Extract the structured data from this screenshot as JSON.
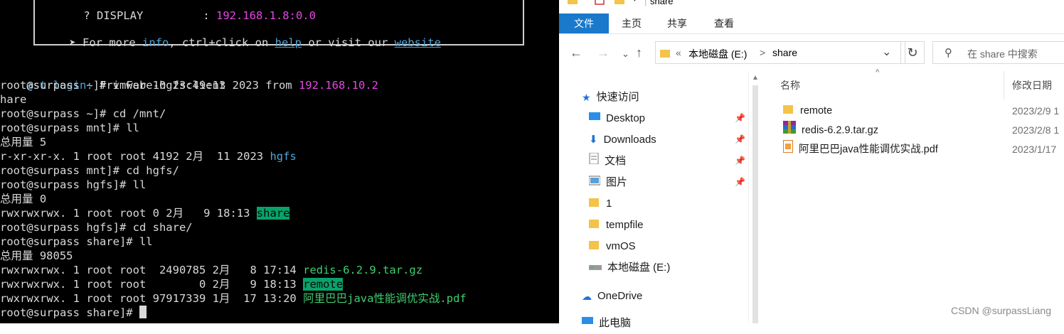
{
  "terminal": {
    "banner": {
      "display_label": "? DISPLAY",
      "display_value": "192.168.1.8:0.0",
      "info_line": {
        "arrow": "➤",
        "prefix": "For more ",
        "info": "info",
        "middle": ", ctrl+click on ",
        "help": "help",
        "or_visit": " or visit our ",
        "website": "website"
      }
    },
    "lines": [
      {
        "a": "ast login: ",
        "b": "Fri Feb 10 23:49:13 2023 from ",
        "c": "192.168.10.2"
      },
      {
        "text": "root@surpass ~]# vmware-hgfsclient"
      },
      {
        "text": "hare"
      },
      {
        "text": "root@surpass ~]# cd /mnt/"
      },
      {
        "text": "root@surpass mnt]# ll"
      },
      {
        "text": "总用量 5"
      },
      {
        "text": "r-xr-xr-x. 1 root root 4192 2月  11 2023 ",
        "item": "hgfs"
      },
      {
        "text": "root@surpass mnt]# cd hgfs/"
      },
      {
        "text": "root@surpass hgfs]# ll"
      },
      {
        "text": "总用量 0"
      },
      {
        "text": "rwxrwxrwx. 1 root root 0 2月   9 18:13 ",
        "item": "share"
      },
      {
        "text": "root@surpass hgfs]# cd share/"
      },
      {
        "text": "root@surpass share]# ll"
      },
      {
        "text": "总用量 98055"
      },
      {
        "text": "rwxrwxrwx. 1 root root  2490785 2月   8 17:14 ",
        "item": "redis-6.2.9.tar.gz"
      },
      {
        "text": "rwxrwxrwx. 1 root root        0 2月   9 18:13 ",
        "item": "remote"
      },
      {
        "text": "rwxrwxrwx. 1 root root 97917339 1月  17 13:20 ",
        "item": "阿里巴巴java性能调优实战.pdf"
      },
      {
        "text": "root@surpass share]# "
      }
    ]
  },
  "explorer": {
    "title": "share",
    "ribbon_tabs": [
      "文件",
      "主页",
      "共享",
      "查看"
    ],
    "address": {
      "chevrons": "«",
      "drive": "本地磁盘 (E:)",
      "arrow": ">",
      "folder": "share"
    },
    "search_placeholder": "在 share 中搜索",
    "nav": {
      "quick_access": "快速访问",
      "items": [
        "Desktop",
        "Downloads",
        "文档",
        "图片",
        "1",
        "tempfile",
        "vmOS",
        "本地磁盘 (E:)"
      ],
      "onedrive": "OneDrive",
      "this_pc": "此电脑"
    },
    "columns": {
      "name": "名称",
      "date": "修改日期"
    },
    "files": [
      {
        "name": "remote",
        "date": "2023/2/9 1",
        "type": "folder"
      },
      {
        "name": "redis-6.2.9.tar.gz",
        "date": "2023/2/8 1",
        "type": "archive"
      },
      {
        "name": "阿里巴巴java性能调优实战.pdf",
        "date": "2023/1/17",
        "type": "pdf"
      }
    ],
    "watermark": "CSDN @surpassLiang"
  },
  "colors": {
    "accent": "#1979ca",
    "terminal_bg": "#000000",
    "highlight": "#07a36a",
    "pink": "#e447e4",
    "teal": "#4fa3d9"
  }
}
